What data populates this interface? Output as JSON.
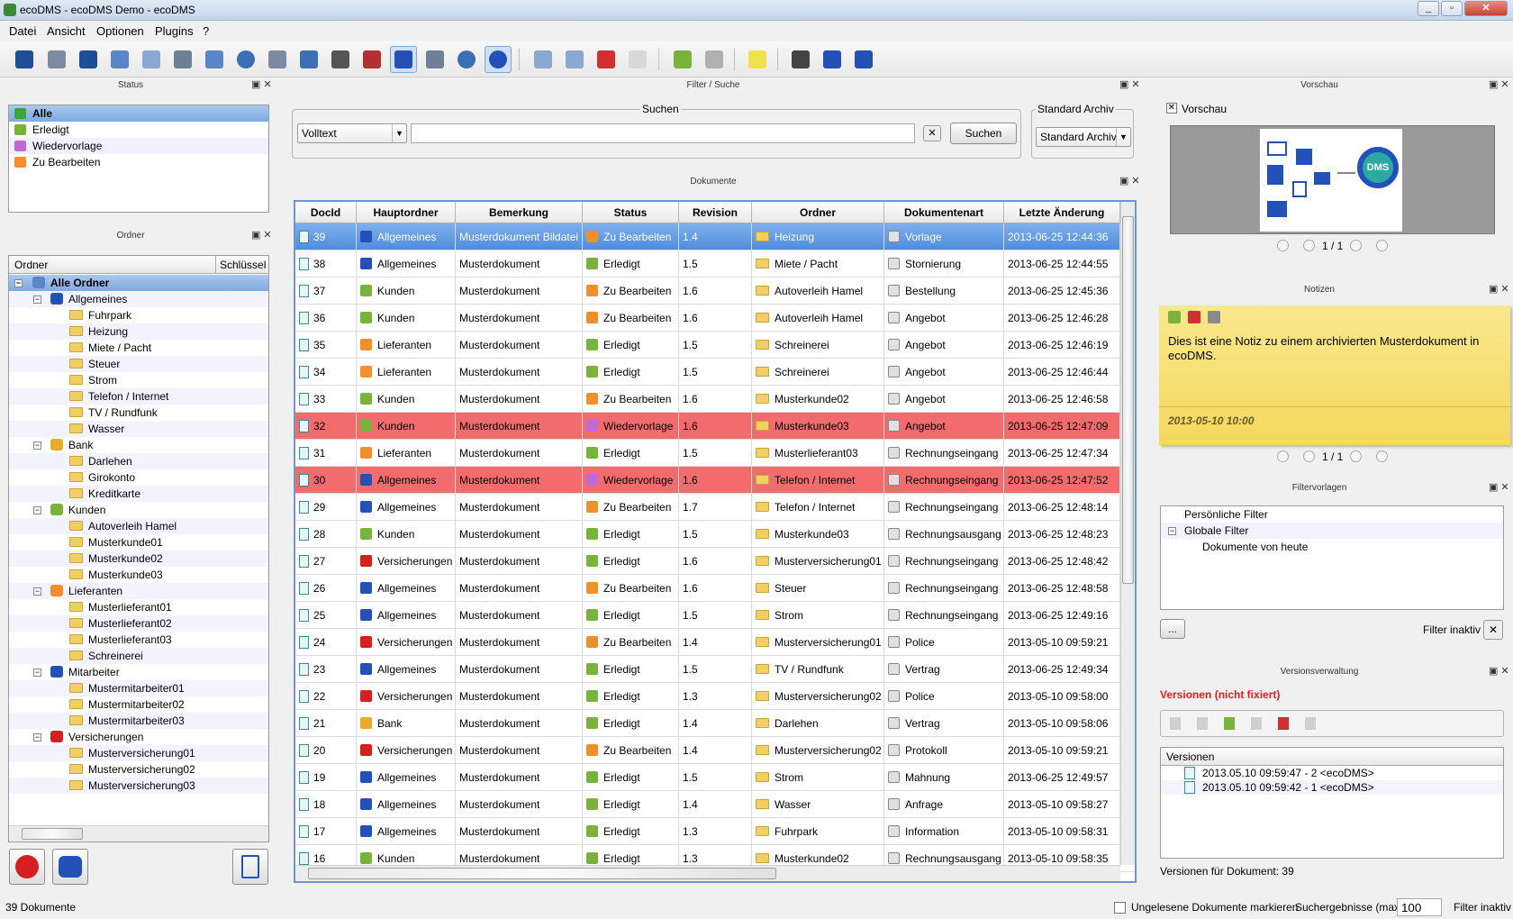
{
  "window": {
    "title": "ecoDMS - ecoDMS Demo - ecoDMS"
  },
  "menu": {
    "items": [
      "Datei",
      "Ansicht",
      "Optionen",
      "Plugins",
      "?"
    ]
  },
  "panels": {
    "status": "Status",
    "filter_search": "Filter / Suche",
    "documents": "Dokumente",
    "folder": "Ordner",
    "preview": "Vorschau",
    "notes": "Notizen",
    "filter_templates": "Filtervorlagen",
    "versions": "Versionsverwaltung"
  },
  "status_list": [
    "Alle",
    "Erledigt",
    "Wiedervorlage",
    "Zu Bearbeiten"
  ],
  "tree": {
    "col_folder": "Ordner",
    "col_key": "Schlüssel",
    "root": "Alle Ordner",
    "groups": [
      {
        "label": "Allgemeines",
        "icon": "puzzle-icon",
        "color": "#2451b8",
        "children": [
          "Fuhrpark",
          "Heizung",
          "Miete / Pacht",
          "Steuer",
          "Strom",
          "Telefon / Internet",
          "TV / Rundfunk",
          "Wasser"
        ]
      },
      {
        "label": "Bank",
        "icon": "bank-icon",
        "color": "#e8a92c",
        "children": [
          "Darlehen",
          "Girokonto",
          "Kreditkarte"
        ]
      },
      {
        "label": "Kunden",
        "icon": "people-icon",
        "color": "#7ab33b",
        "children": [
          "Autoverleih Hamel",
          "Musterkunde01",
          "Musterkunde02",
          "Musterkunde03"
        ]
      },
      {
        "label": "Lieferanten",
        "icon": "people-icon",
        "color": "#f0902c",
        "children": [
          "Musterlieferant01",
          "Musterlieferant02",
          "Musterlieferant03",
          "Schreinerei"
        ]
      },
      {
        "label": "Mitarbeiter",
        "icon": "people-icon",
        "color": "#2451b8",
        "children": [
          "Mustermitarbeiter01",
          "Mustermitarbeiter02",
          "Mustermitarbeiter03"
        ]
      },
      {
        "label": "Versicherungen",
        "icon": "shield-icon",
        "color": "#d42020",
        "children": [
          "Musterversicherung01",
          "Musterversicherung02",
          "Musterversicherung03"
        ]
      }
    ]
  },
  "search": {
    "group_label": "Suchen",
    "mode": "Volltext",
    "query": "",
    "button": "Suchen",
    "archive_group": "Standard Archiv",
    "archive_value": "Standard Archiv"
  },
  "table": {
    "columns": [
      "DocId",
      "Hauptordner",
      "Bemerkung",
      "Status",
      "Revision",
      "Ordner",
      "Dokumentenart",
      "Letzte Änderung"
    ],
    "rows": [
      [
        "39",
        "Allgemeines",
        "Musterdokument Bildatei",
        "Zu Bearbeiten",
        "1.4",
        "Heizung",
        "Vorlage",
        "2013-06-25 12:44:36"
      ],
      [
        "38",
        "Allgemeines",
        "Musterdokument",
        "Erledigt",
        "1.5",
        "Miete / Pacht",
        "Stornierung",
        "2013-06-25 12:44:55"
      ],
      [
        "37",
        "Kunden",
        "Musterdokument",
        "Zu Bearbeiten",
        "1.6",
        "Autoverleih Hamel",
        "Bestellung",
        "2013-06-25 12:45:36"
      ],
      [
        "36",
        "Kunden",
        "Musterdokument",
        "Zu Bearbeiten",
        "1.6",
        "Autoverleih Hamel",
        "Angebot",
        "2013-06-25 12:46:28"
      ],
      [
        "35",
        "Lieferanten",
        "Musterdokument",
        "Erledigt",
        "1.5",
        "Schreinerei",
        "Angebot",
        "2013-06-25 12:46:19"
      ],
      [
        "34",
        "Lieferanten",
        "Musterdokument",
        "Erledigt",
        "1.5",
        "Schreinerei",
        "Angebot",
        "2013-06-25 12:46:44"
      ],
      [
        "33",
        "Kunden",
        "Musterdokument",
        "Zu Bearbeiten",
        "1.6",
        "Musterkunde02",
        "Angebot",
        "2013-06-25 12:46:58"
      ],
      [
        "32",
        "Kunden",
        "Musterdokument",
        "Wiedervorlage",
        "1.6",
        "Musterkunde03",
        "Angebot",
        "2013-06-25 12:47:09"
      ],
      [
        "31",
        "Lieferanten",
        "Musterdokument",
        "Erledigt",
        "1.5",
        "Musterlieferant03",
        "Rechnungseingang",
        "2013-06-25 12:47:34"
      ],
      [
        "30",
        "Allgemeines",
        "Musterdokument",
        "Wiedervorlage",
        "1.6",
        "Telefon / Internet",
        "Rechnungseingang",
        "2013-06-25 12:47:52"
      ],
      [
        "29",
        "Allgemeines",
        "Musterdokument",
        "Zu Bearbeiten",
        "1.7",
        "Telefon / Internet",
        "Rechnungseingang",
        "2013-06-25 12:48:14"
      ],
      [
        "28",
        "Kunden",
        "Musterdokument",
        "Erledigt",
        "1.5",
        "Musterkunde03",
        "Rechnungsausgang",
        "2013-06-25 12:48:23"
      ],
      [
        "27",
        "Versicherungen",
        "Musterdokument",
        "Erledigt",
        "1.6",
        "Musterversicherung01",
        "Rechnungseingang",
        "2013-06-25 12:48:42"
      ],
      [
        "26",
        "Allgemeines",
        "Musterdokument",
        "Zu Bearbeiten",
        "1.6",
        "Steuer",
        "Rechnungseingang",
        "2013-06-25 12:48:58"
      ],
      [
        "25",
        "Allgemeines",
        "Musterdokument",
        "Erledigt",
        "1.5",
        "Strom",
        "Rechnungseingang",
        "2013-06-25 12:49:16"
      ],
      [
        "24",
        "Versicherungen",
        "Musterdokument",
        "Zu Bearbeiten",
        "1.4",
        "Musterversicherung01",
        "Police",
        "2013-05-10 09:59:21"
      ],
      [
        "23",
        "Allgemeines",
        "Musterdokument",
        "Erledigt",
        "1.5",
        "TV / Rundfunk",
        "Vertrag",
        "2013-06-25 12:49:34"
      ],
      [
        "22",
        "Versicherungen",
        "Musterdokument",
        "Erledigt",
        "1.3",
        "Musterversicherung02",
        "Police",
        "2013-05-10 09:58:00"
      ],
      [
        "21",
        "Bank",
        "Musterdokument",
        "Erledigt",
        "1.4",
        "Darlehen",
        "Vertrag",
        "2013-05-10 09:58:06"
      ],
      [
        "20",
        "Versicherungen",
        "Musterdokument",
        "Zu Bearbeiten",
        "1.4",
        "Musterversicherung02",
        "Protokoll",
        "2013-05-10 09:59:21"
      ],
      [
        "19",
        "Allgemeines",
        "Musterdokument",
        "Erledigt",
        "1.5",
        "Strom",
        "Mahnung",
        "2013-06-25 12:49:57"
      ],
      [
        "18",
        "Allgemeines",
        "Musterdokument",
        "Erledigt",
        "1.4",
        "Wasser",
        "Anfrage",
        "2013-05-10 09:58:27"
      ],
      [
        "17",
        "Allgemeines",
        "Musterdokument",
        "Erledigt",
        "1.3",
        "Fuhrpark",
        "Information",
        "2013-05-10 09:58:31"
      ],
      [
        "16",
        "Kunden",
        "Musterdokument",
        "Erledigt",
        "1.3",
        "Musterkunde02",
        "Rechnungsausgang",
        "2013-05-10 09:58:35"
      ]
    ],
    "selected_row": 0,
    "highlight_rows": [
      7,
      9
    ]
  },
  "preview": {
    "checkbox_label": "Vorschau",
    "page": "1 / 1",
    "logo_text": "DMS"
  },
  "note": {
    "text": "Dies ist eine Notiz zu einem archivierten Musterdokument in ecoDMS.",
    "date": "2013-05-10 10:00",
    "page": "1 / 1"
  },
  "filters": {
    "items": [
      "Persönliche Filter",
      "Globale Filter",
      "Dokumente von heute"
    ],
    "more_button": "...",
    "status": "Filter inaktiv"
  },
  "versions": {
    "heading": "Versionen (nicht fixiert)",
    "col": "Versionen",
    "items": [
      "2013.05.10 09:59:47 - 2 <ecoDMS>",
      "2013.05.10 09:59:42 - 1 <ecoDMS>"
    ],
    "footer": "Versionen für Dokument: 39"
  },
  "statusbar": {
    "count": "39 Dokumente",
    "unread_label": "Ungelesene Dokumente markieren",
    "max_label": "Suchergebnisse (max)",
    "max_value": "100",
    "filter": "Filter inaktiv"
  },
  "colors": {
    "accent": "#4f8ddc",
    "highlight_red": "#f26c6e",
    "note_yellow": "#f7e27c"
  }
}
